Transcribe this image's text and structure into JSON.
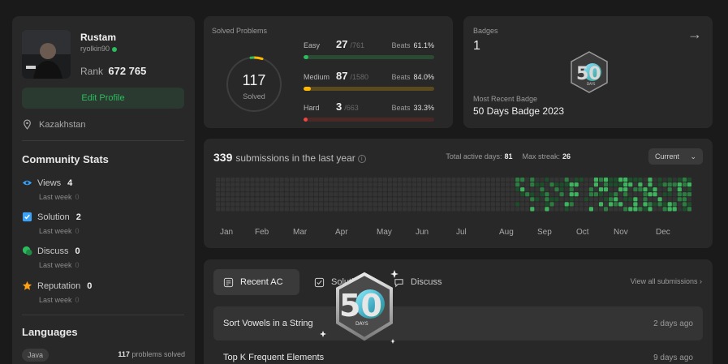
{
  "profile": {
    "name": "Rustam",
    "username": "ryolkin90",
    "rank_label": "Rank",
    "rank_value": "672 765",
    "edit_label": "Edit Profile",
    "location": "Kazakhstan"
  },
  "community": {
    "title": "Community Stats",
    "items": [
      {
        "label": "Views",
        "value": "4",
        "sub_label": "Last week",
        "sub_value": "0",
        "icon": "eye-icon",
        "color": "#3ba3f7"
      },
      {
        "label": "Solution",
        "value": "2",
        "sub_label": "Last week",
        "sub_value": "0",
        "icon": "check-square-icon",
        "color": "#3ba3f7"
      },
      {
        "label": "Discuss",
        "value": "0",
        "sub_label": "Last week",
        "sub_value": "0",
        "icon": "chat-icon",
        "color": "#2cbb5d"
      },
      {
        "label": "Reputation",
        "value": "0",
        "sub_label": "Last week",
        "sub_value": "0",
        "icon": "star-icon",
        "color": "#ffa116"
      }
    ]
  },
  "languages": {
    "title": "Languages",
    "items": [
      {
        "name": "Java",
        "count": "117",
        "suffix": "problems solved"
      }
    ]
  },
  "solved": {
    "title": "Solved Problems",
    "total": "117",
    "total_label": "Solved",
    "difficulties": [
      {
        "name": "Easy",
        "count": "27",
        "total": "/761",
        "beats_label": "Beats",
        "beats": "61.1%",
        "fraction": 0.035,
        "color": "#2cbb5d",
        "track": "#2a4a33"
      },
      {
        "name": "Medium",
        "count": "87",
        "total": "/1580",
        "beats_label": "Beats",
        "beats": "84.0%",
        "fraction": 0.055,
        "color": "#ffb700",
        "track": "#5a4a1e"
      },
      {
        "name": "Hard",
        "count": "3",
        "total": "/663",
        "beats_label": "Beats",
        "beats": "33.3%",
        "fraction": 0.005,
        "color": "#ef4743",
        "track": "#4a2826"
      }
    ]
  },
  "badges": {
    "title": "Badges",
    "count": "1",
    "recent_label": "Most Recent Badge",
    "recent_name": "50 Days Badge 2023",
    "badge_num": "50",
    "badge_sub": "DAYS"
  },
  "heatmap": {
    "count": "339",
    "title_suffix": "submissions in the last year",
    "active_label": "Total active days:",
    "active_value": "81",
    "streak_label": "Max streak:",
    "streak_value": "26",
    "select_value": "Current",
    "months": [
      "Jan",
      "Feb",
      "Mar",
      "Apr",
      "May",
      "Jun",
      "Jul",
      "Aug",
      "Sep",
      "Oct",
      "Nov",
      "Dec"
    ]
  },
  "activity": {
    "tabs": [
      "Recent AC",
      "Solutions",
      "Discuss"
    ],
    "view_all": "View all submissions",
    "rows": [
      {
        "title": "Sort Vowels in a String",
        "time": "2 days ago"
      },
      {
        "title": "Top K Frequent Elements",
        "time": "9 days ago"
      }
    ]
  }
}
